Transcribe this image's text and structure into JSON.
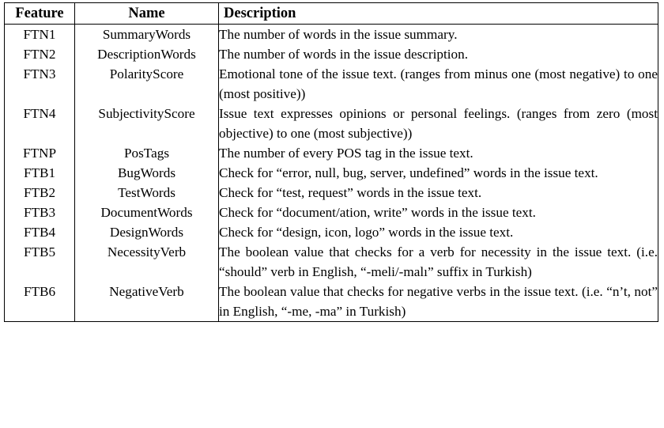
{
  "table": {
    "columns": [
      {
        "key": "feature",
        "label": "Feature"
      },
      {
        "key": "name",
        "label": "Name"
      },
      {
        "key": "description",
        "label": "Description"
      }
    ],
    "rows": [
      {
        "feature": "FTN1",
        "name": "SummaryWords",
        "description": "The number of words in the issue summary."
      },
      {
        "feature": "FTN2",
        "name": "DescriptionWords",
        "description": "The number of words in the issue description."
      },
      {
        "feature": "FTN3",
        "name": "PolarityScore",
        "description": "Emotional tone of the issue text. (ranges from minus one (most negative) to one (most positive))"
      },
      {
        "feature": "FTN4",
        "name": "SubjectivityScore",
        "description": "Issue text expresses opinions or personal feelings. (ranges from zero (most objective) to one (most subjective))"
      },
      {
        "feature": "FTNP",
        "name": "PosTags",
        "description": "The number of every POS tag in the issue text."
      },
      {
        "feature": "FTB1",
        "name": "BugWords",
        "description": "Check for “error, null, bug, server, undefined” words in the issue text."
      },
      {
        "feature": "FTB2",
        "name": "TestWords",
        "description": "Check for “test, request” words in the issue text."
      },
      {
        "feature": "FTB3",
        "name": "DocumentWords",
        "description": "Check for “document/ation, write” words in the issue text."
      },
      {
        "feature": "FTB4",
        "name": "DesignWords",
        "description": "Check for “design, icon, logo” words in the issue text."
      },
      {
        "feature": "FTB5",
        "name": "NecessityVerb",
        "description": "The boolean value that checks for a verb for necessity in the issue text. (i.e. “should” verb in English, “-meli/-malı” suffix in Turkish)"
      },
      {
        "feature": "FTB6",
        "name": "NegativeVerb",
        "description": "The boolean value that checks for negative verbs in the issue text. (i.e. “n’t, not” in English, “-me, -ma” in Turk­ish)"
      }
    ]
  }
}
